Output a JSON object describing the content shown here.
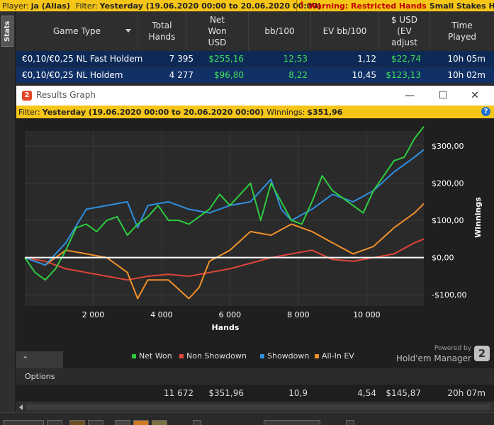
{
  "topbar": {
    "player_label": "Player:",
    "player_value": "ja (Alias)",
    "filter_label": "Filter:",
    "filter_value": "Yesterday (19.06.2020 00:00 to 20.06.2020 00:00)",
    "warning_icon": "!",
    "warning_label": "Warning: Restricted Hands",
    "warning_rest": "Small Stakes Holdem ha"
  },
  "stats_tab": {
    "label": "Stats"
  },
  "table": {
    "headers": {
      "game_type": "Game Type",
      "total_hands_1": "Total",
      "total_hands_2": "Hands",
      "net_won_1": "Net",
      "net_won_2": "Won",
      "net_won_3": "USD",
      "bb100": "bb/100",
      "ev_bb100": "EV bb/100",
      "usd_ev_1": "$ USD",
      "usd_ev_2": "(EV",
      "usd_ev_3": "adjust",
      "time_1": "Time",
      "time_2": "Played"
    },
    "rows": [
      {
        "game": "€0,10/€0,25 NL Fast Holdem",
        "hands": "7 395",
        "net": "$255,16",
        "bb100": "12,53",
        "evbb": "1,12",
        "usdev": "$22,74",
        "time": "10h 05m"
      },
      {
        "game": "€0,10/€0,25 NL Holdem",
        "hands": "4 277",
        "net": "$96,80",
        "bb100": "8,22",
        "evbb": "10,45",
        "usdev": "$123,13",
        "time": "10h 02m"
      }
    ],
    "totals": {
      "hands": "11 672",
      "net": "$351,96",
      "bb100": "10,9",
      "evbb": "4,54",
      "usdev": "$145,87",
      "time": "20h 07m"
    }
  },
  "graph_window": {
    "logo": "2",
    "title": "Results Graph",
    "minimize_icon": "—",
    "maximize_icon": "☐",
    "close_icon": "✕",
    "filter_label": "Filter:",
    "filter_value": "Yesterday (19.06.2020 00:00 to 20.06.2020 00:00)",
    "winnings_label": "Winnings:",
    "winnings_value": "$351,96",
    "help_icon": "?",
    "options_label": "Options",
    "powered_by": "Powered by",
    "brand": "Hold'em Manager",
    "brand_badge": "2"
  },
  "chart_data": {
    "type": "line",
    "xlabel": "Hands",
    "ylabel": "Winnings",
    "xlim": [
      0,
      11672
    ],
    "ylim": [
      -130,
      340
    ],
    "x_ticks": [
      2000,
      4000,
      6000,
      8000,
      10000
    ],
    "x_tick_labels": [
      "2 000",
      "4 000",
      "6 000",
      "8 000",
      "10 000"
    ],
    "y_ticks": [
      300,
      200,
      100,
      0,
      -100
    ],
    "y_tick_labels": [
      "$300,00",
      "$200,00",
      "$100,00",
      "$0,00",
      "-$100,00"
    ],
    "grid": true,
    "legend_position": "bottom",
    "colors": {
      "net_won": "#2ecc40",
      "non_showdown": "#e0443a",
      "showdown": "#2f8fe0",
      "all_in_ev": "#f0902a"
    },
    "series": [
      {
        "name": "Net Won",
        "color": "#2ecc40",
        "x": [
          0,
          300,
          600,
          900,
          1200,
          1500,
          1800,
          2100,
          2400,
          2700,
          3000,
          3300,
          3600,
          3900,
          4200,
          4500,
          4800,
          5100,
          5400,
          5700,
          6000,
          6300,
          6600,
          6900,
          7200,
          7500,
          7800,
          8100,
          8400,
          8700,
          9000,
          9300,
          9600,
          9900,
          10200,
          10500,
          10800,
          11100,
          11400,
          11672
        ],
        "values": [
          0,
          -40,
          -60,
          -30,
          20,
          80,
          90,
          70,
          100,
          110,
          60,
          90,
          110,
          140,
          100,
          100,
          90,
          110,
          130,
          170,
          140,
          170,
          200,
          100,
          200,
          150,
          100,
          90,
          150,
          220,
          180,
          160,
          140,
          120,
          180,
          220,
          260,
          270,
          320,
          351.96
        ]
      },
      {
        "name": "Non Showdown",
        "color": "#e0443a",
        "x": [
          0,
          600,
          1200,
          1800,
          2400,
          3000,
          3600,
          4200,
          4800,
          5400,
          6000,
          6600,
          7200,
          7800,
          8400,
          9000,
          9600,
          10200,
          10800,
          11400,
          11672
        ],
        "values": [
          0,
          -10,
          -30,
          -40,
          -50,
          -60,
          -50,
          -45,
          -50,
          -40,
          -30,
          -15,
          0,
          10,
          20,
          -5,
          -10,
          0,
          10,
          40,
          50
        ]
      },
      {
        "name": "Showdown",
        "color": "#2f8fe0",
        "x": [
          0,
          600,
          1200,
          1800,
          2400,
          3000,
          3300,
          3600,
          4200,
          4800,
          5400,
          6000,
          6600,
          7200,
          7500,
          7800,
          8400,
          9000,
          9600,
          10200,
          10800,
          11400,
          11672
        ],
        "values": [
          0,
          -20,
          40,
          130,
          140,
          150,
          80,
          140,
          150,
          130,
          120,
          140,
          150,
          210,
          130,
          100,
          130,
          170,
          150,
          180,
          230,
          270,
          290
        ]
      },
      {
        "name": "All-In EV",
        "color": "#f0902a",
        "x": [
          0,
          600,
          1200,
          1800,
          2400,
          3000,
          3300,
          3600,
          4200,
          4800,
          5100,
          5400,
          6000,
          6600,
          7200,
          7800,
          8400,
          9000,
          9600,
          10200,
          10800,
          11400,
          11672
        ],
        "values": [
          0,
          -20,
          20,
          10,
          0,
          -40,
          -110,
          -60,
          -60,
          -110,
          -80,
          -10,
          20,
          70,
          60,
          90,
          70,
          40,
          10,
          30,
          80,
          120,
          145
        ]
      }
    ]
  }
}
